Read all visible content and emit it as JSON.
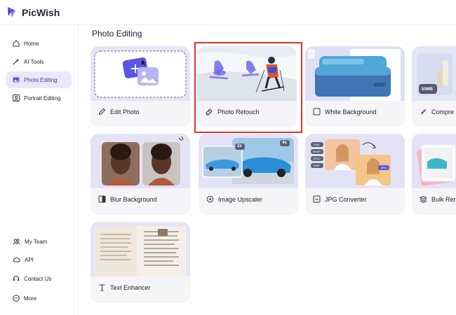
{
  "app": {
    "name": "PicWish"
  },
  "sidebar": {
    "items": [
      {
        "label": "Home",
        "icon": "home-icon"
      },
      {
        "label": "AI Tools",
        "icon": "magic-wand-icon"
      },
      {
        "label": "Photo Editing",
        "icon": "photo-edit-icon",
        "active": true
      },
      {
        "label": "Portrait Editing",
        "icon": "portrait-icon"
      }
    ],
    "bottom_items": [
      {
        "label": "My Team",
        "icon": "team-icon"
      },
      {
        "label": "API",
        "icon": "api-cloud-icon"
      },
      {
        "label": "Contact Us",
        "icon": "headset-icon"
      },
      {
        "label": "More",
        "icon": "more-icon"
      }
    ]
  },
  "main": {
    "section_title": "Photo Editing",
    "tools": [
      {
        "label": "Edit Photo",
        "icon": "pencil-icon"
      },
      {
        "label": "Photo Retouch",
        "icon": "eraser-icon",
        "highlighted": true
      },
      {
        "label": "White Background",
        "icon": "square-icon"
      },
      {
        "label": "Compre",
        "icon": "compress-icon"
      },
      {
        "label": "Blur Background",
        "icon": "blur-icon"
      },
      {
        "label": "Image Upscaler",
        "icon": "zoom-plus-icon"
      },
      {
        "label": "JPG Converter",
        "icon": "jpg-file-icon"
      },
      {
        "label": "Bulk Rer",
        "icon": "stack-icon"
      },
      {
        "label": "Text Enhancer",
        "icon": "text-icon"
      }
    ],
    "thumb_badges": {
      "compress_size": "50MB",
      "upscale_small": "2x",
      "upscale_large": "4x",
      "format_tags": [
        "PNG",
        "WebP",
        "JPEG",
        "BMP"
      ],
      "jpg_tag": "JPG"
    }
  },
  "colors": {
    "accent": "#5b57e0",
    "active_bg": "#e9e8fb",
    "card_bg": "#f5f5f8",
    "highlight": "#d9342b"
  }
}
